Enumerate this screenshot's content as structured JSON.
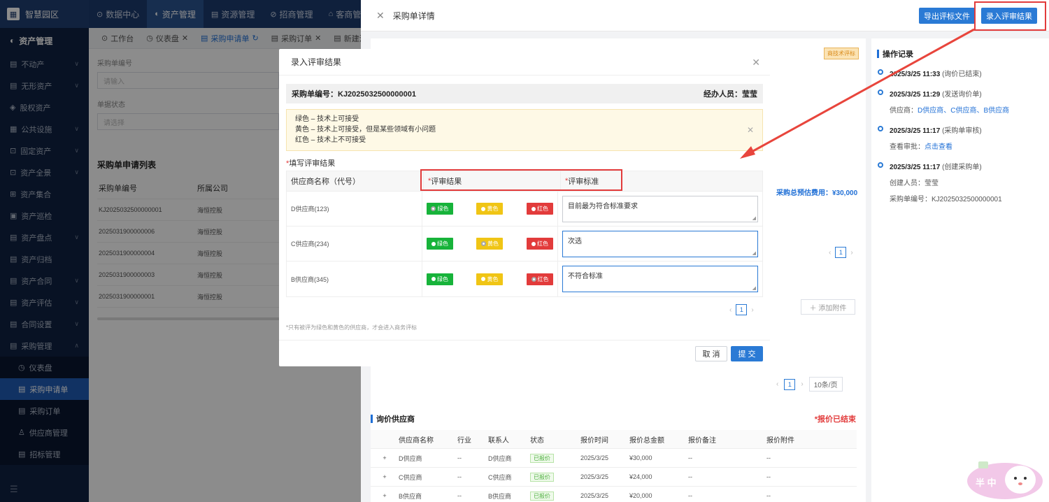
{
  "app": {
    "logo_text": "智慧园区"
  },
  "topnav": [
    {
      "icon": "⊙",
      "label": "数据中心"
    },
    {
      "icon": "◐",
      "label": "资产管理"
    },
    {
      "icon": "▤",
      "label": "资源管理"
    },
    {
      "icon": "⊘",
      "label": "招商管理"
    },
    {
      "icon": "⌂",
      "label": "客商管理"
    }
  ],
  "sidebar": {
    "header": "资产管理",
    "items": [
      {
        "icon": "▤",
        "label": "不动产"
      },
      {
        "icon": "▤",
        "label": "无形资产"
      },
      {
        "icon": "◈",
        "label": "股权资产"
      },
      {
        "icon": "▦",
        "label": "公共设施"
      },
      {
        "icon": "⊡",
        "label": "固定资产"
      },
      {
        "icon": "⊡",
        "label": "资产全景"
      },
      {
        "icon": "⊞",
        "label": "资产集合"
      },
      {
        "icon": "▣",
        "label": "资产巡检"
      },
      {
        "icon": "▤",
        "label": "资产盘点"
      },
      {
        "icon": "▤",
        "label": "资产归档"
      },
      {
        "icon": "▤",
        "label": "资产合同"
      },
      {
        "icon": "▤",
        "label": "资产评估"
      },
      {
        "icon": "▤",
        "label": "合同设置"
      },
      {
        "icon": "▤",
        "label": "采购管理"
      }
    ],
    "subitems": [
      {
        "icon": "◷",
        "label": "仪表盘"
      },
      {
        "icon": "▤",
        "label": "采购申请单"
      },
      {
        "icon": "▤",
        "label": "采购订单"
      },
      {
        "icon": "♙",
        "label": "供应商管理"
      },
      {
        "icon": "▤",
        "label": "招标管理"
      }
    ],
    "footer_icon": "☰"
  },
  "tabs": [
    {
      "label": "工作台"
    },
    {
      "label": "仪表盘"
    },
    {
      "label": "采购申请单"
    },
    {
      "label": "采购订单"
    },
    {
      "label": "新建流"
    }
  ],
  "list": {
    "filter1_label": "采购单编号",
    "filter1_placeholder": "请输入",
    "filter2_label": "单据状态",
    "filter2_placeholder": "请选择",
    "title": "采购单申请列表",
    "col1": "采购单编号",
    "col2": "所属公司",
    "rows": [
      {
        "code": "KJ2025032500000001",
        "company": "海恒控股"
      },
      {
        "code": "2025031900000006",
        "company": "海恒控股"
      },
      {
        "code": "2025031900000004",
        "company": "海恒控股"
      },
      {
        "code": "2025031900000003",
        "company": "海恒控股"
      },
      {
        "code": "2025031900000001",
        "company": "海恒控股"
      }
    ]
  },
  "drawer": {
    "title": "采购单详情",
    "export_btn": "导出评标文件",
    "enter_btn": "录入评审结果",
    "tech_badge": "商技术评标",
    "est_cost": "采购总预估费用：¥30,000",
    "page_num": "1",
    "add_attach": "＋ 添加附件",
    "page_num2": "1",
    "page_size": "10条/页",
    "suppliers_title": "询价供应商",
    "suppliers_status": "*报价已结束",
    "sup_cols": [
      "供应商名称",
      "行业",
      "联系人",
      "状态",
      "报价时间",
      "报价总金额",
      "报价备注",
      "报价附件"
    ],
    "sup_rows": [
      {
        "name": "D供应商",
        "industry": "--",
        "contact": "D供应商",
        "status": "已报价",
        "time": "2025/3/25",
        "amount": "¥30,000",
        "note": "--",
        "file": "--"
      },
      {
        "name": "C供应商",
        "industry": "--",
        "contact": "C供应商",
        "status": "已报价",
        "time": "2025/3/25",
        "amount": "¥24,000",
        "note": "--",
        "file": "--"
      },
      {
        "name": "B供应商",
        "industry": "--",
        "contact": "B供应商",
        "status": "已报价",
        "time": "2025/3/25",
        "amount": "¥20,000",
        "note": "--",
        "file": "--"
      }
    ],
    "ops_title": "操作记录",
    "ops": [
      {
        "time": "2025/3/25 11:33",
        "action": "(询价已结束)"
      },
      {
        "time": "2025/3/25 11:29",
        "action": "(发送询价单)",
        "sub_label": "供应商：",
        "sub_value": "D供应商、C供应商、B供应商"
      },
      {
        "time": "2025/3/25 11:17",
        "action": "(采购单审核)",
        "sub_label": "查看审批：",
        "sub_value": "点击查看"
      },
      {
        "time": "2025/3/25 11:17",
        "action": "(创建采购单)",
        "sub_label": "创建人员：莹莹",
        "sub2_label": "采购单编号：KJ2025032500000001"
      }
    ]
  },
  "modal": {
    "title": "录入评审结果",
    "order_no": "采购单编号：KJ2025032500000001",
    "handler": "经办人员：莹莹",
    "legend": [
      "绿色 – 技术上可接受",
      "黄色 – 技术上可接受，但是某些领域有小问题",
      "红色 – 技术上不可接受"
    ],
    "fill_label": "填写评审结果",
    "col_supplier": "供应商名称（代号）",
    "col_result": "评审结果",
    "col_standard": "评审标准",
    "green_label": "绿色",
    "yellow_label": "黄色",
    "red_label": "红色",
    "rows": [
      {
        "supplier": "D供应商(123)",
        "selected": "green",
        "standard": "目前最为符合标准要求"
      },
      {
        "supplier": "C供应商(234)",
        "selected": "yellow",
        "standard": "次选"
      },
      {
        "supplier": "B供应商(345)",
        "selected": "red",
        "standard": "不符合标准"
      }
    ],
    "page_num": "1",
    "note": "*只有被评为绿色和黄色的供应商，才会进入商务评标",
    "cancel": "取 消",
    "submit": "提 交"
  },
  "colors": {
    "primary": "#2a7ad5",
    "annotation": "#e23b3b",
    "green": "#17b33a",
    "yellow": "#f0c515",
    "red": "#e23b3b"
  },
  "mascot": {
    "text": "半 中"
  }
}
